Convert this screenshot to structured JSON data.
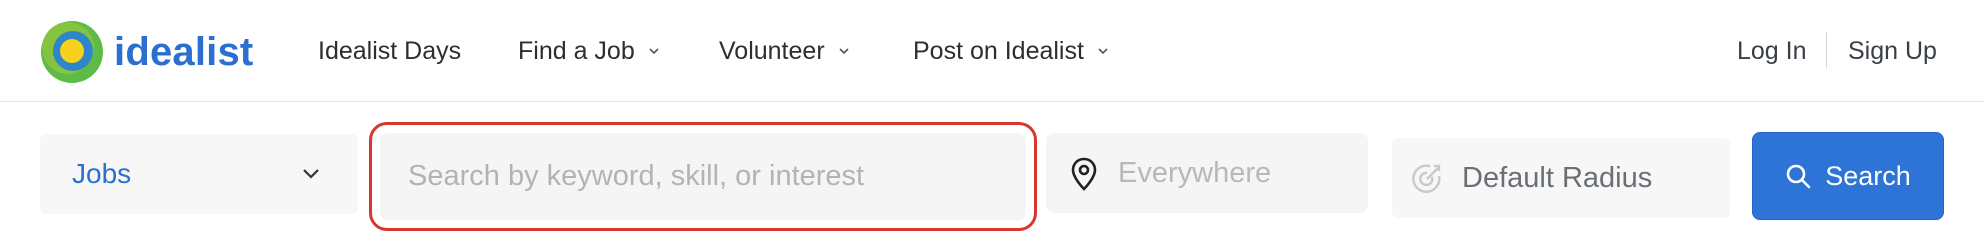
{
  "brand": {
    "name": "idealist",
    "logo_icon": "idealist-logo-icon",
    "color": "#2b6fd0"
  },
  "nav": {
    "items": [
      {
        "label": "Idealist Days",
        "has_dropdown": false
      },
      {
        "label": "Find a Job",
        "has_dropdown": true
      },
      {
        "label": "Volunteer",
        "has_dropdown": true
      },
      {
        "label": "Post on Idealist",
        "has_dropdown": true
      }
    ]
  },
  "auth": {
    "login_label": "Log In",
    "signup_label": "Sign Up"
  },
  "search": {
    "type_select": {
      "value": "Jobs",
      "icon": "chevron-down-icon"
    },
    "keyword": {
      "value": "",
      "placeholder": "Search by keyword, skill, or interest",
      "highlight_color": "#d7372e"
    },
    "location": {
      "value": "",
      "placeholder": "Everywhere",
      "icon": "map-pin-icon"
    },
    "radius": {
      "label": "Default Radius",
      "icon": "radius-target-icon"
    },
    "submit": {
      "label": "Search",
      "icon": "search-icon",
      "color": "#2d74d6"
    }
  }
}
